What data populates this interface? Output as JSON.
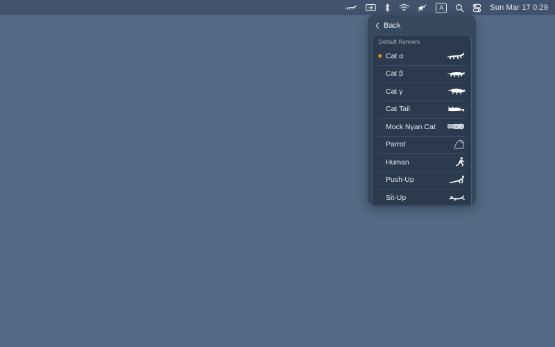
{
  "desktop": {
    "background_color": "#546a86"
  },
  "menubar": {
    "background_color": "#41536c",
    "items": [
      {
        "name": "runcat-status-icon",
        "icon": "running-cat-icon",
        "label": ""
      },
      {
        "name": "screen-mirroring-icon",
        "icon": "screen-mirroring-icon",
        "label": ""
      },
      {
        "name": "bluetooth-icon",
        "icon": "bluetooth-icon",
        "label": ""
      },
      {
        "name": "wifi-icon",
        "icon": "wifi-icon",
        "label": ""
      },
      {
        "name": "volume-muted-icon",
        "icon": "speaker-mute-icon",
        "label": ""
      },
      {
        "name": "input-source-icon",
        "icon": "keyboard-input-source-icon",
        "label": "A"
      },
      {
        "name": "spotlight-search-icon",
        "icon": "search-icon",
        "label": ""
      },
      {
        "name": "control-center-icon",
        "icon": "control-center-icon",
        "label": ""
      }
    ],
    "clock": "Sun Mar 17  0:29"
  },
  "panel": {
    "background_color": "#35485e",
    "header": {
      "back_label": "Back",
      "back_icon": "chevron-left-icon"
    },
    "group_title": "Default Runners",
    "selected_color": "#e8881f",
    "runners": [
      {
        "label": "Cat α",
        "icon": "cat-alpha-icon",
        "selected": true
      },
      {
        "label": "Cat β",
        "icon": "cat-beta-icon",
        "selected": false
      },
      {
        "label": "Cat γ",
        "icon": "cat-gamma-icon",
        "selected": false
      },
      {
        "label": "Cat Tail",
        "icon": "cat-tail-icon",
        "selected": false
      },
      {
        "label": "Mock Nyan Cat",
        "icon": "nyan-cat-icon",
        "selected": false
      },
      {
        "label": "Parrot",
        "icon": "parrot-icon",
        "selected": false
      },
      {
        "label": "Human",
        "icon": "human-run-icon",
        "selected": false
      },
      {
        "label": "Push-Up",
        "icon": "push-up-icon",
        "selected": false
      },
      {
        "label": "Sit-Up",
        "icon": "sit-up-icon",
        "selected": false
      }
    ]
  }
}
